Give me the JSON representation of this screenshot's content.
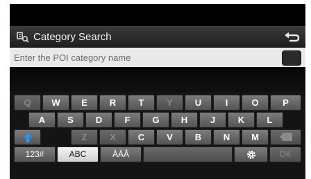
{
  "header": {
    "title": "Category Search",
    "title_icon": "poi-category-icon",
    "back_icon": "back-arrow-icon"
  },
  "search": {
    "placeholder": "Enter the POI category name",
    "value": "",
    "clear_icon": "clear-icon"
  },
  "keyboard": {
    "row1": [
      "Q",
      "W",
      "E",
      "R",
      "T",
      "Y",
      "U",
      "I",
      "O",
      "P"
    ],
    "row2": [
      "A",
      "S",
      "D",
      "F",
      "G",
      "H",
      "J",
      "K",
      "L"
    ],
    "row3_letters": [
      "Z",
      "X",
      "C",
      "V",
      "B",
      "N",
      "M"
    ],
    "shift_icon": "shift-up-arrow-icon",
    "backspace_icon": "backspace-icon",
    "mode_123": "123#",
    "mode_abc": "ABC",
    "mode_accent": "ÀÁÂ",
    "settings_icon": "gear-icon",
    "ok": "OK",
    "disabled_keys": [
      "Q",
      "Y",
      "Z",
      "X",
      "backspace",
      "space",
      "OK"
    ],
    "selected_mode": "ABC",
    "colors": {
      "key": "#6b6b6b",
      "key_selected": "#e6e6e6",
      "shift_arrow": "#2e8fe8",
      "background": "#141414"
    }
  }
}
